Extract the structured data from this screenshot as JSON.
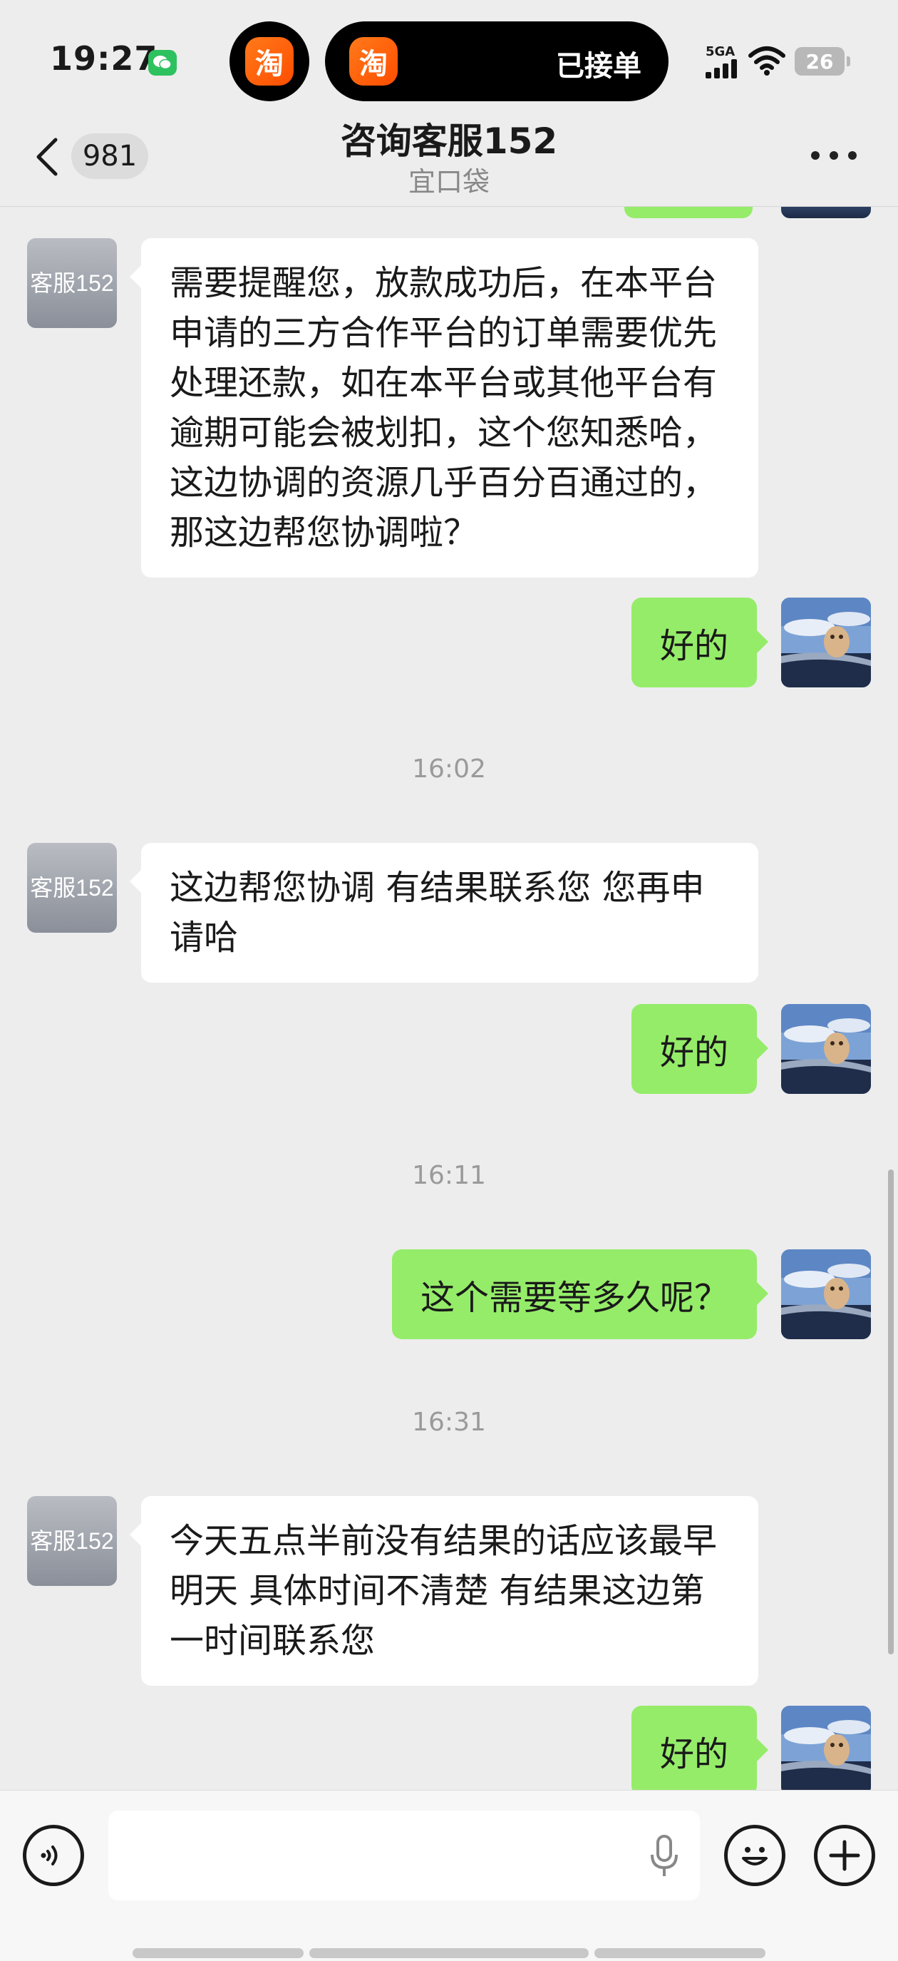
{
  "status_bar": {
    "time": "19:27",
    "island_app_glyph": "淘",
    "island_status": "已接单",
    "network": "5GA",
    "battery": "26"
  },
  "nav": {
    "unread_count": "981",
    "title": "咨询客服152",
    "subtitle": "宜口袋"
  },
  "agent_avatar_label": "客服152",
  "messages": {
    "m1": "需要提醒您，放款成功后，在本平台申请的三方合作平台的订单需要优先处理还款，如在本平台或其他平台有逾期可能会被划扣，这个您知悉哈，这边协调的资源几乎百分百通过的，那这边帮您协调啦？",
    "m2": "好的",
    "t1": "16:02",
    "m3": "这边帮您协调 有结果联系您 您再申请哈",
    "m4": "好的",
    "t2": "16:11",
    "m5": "这个需要等多久呢？",
    "t3": "16:31",
    "m6": "今天五点半前没有结果的话应该最早明天 具体时间不清楚 有结果这边第一时间联系您",
    "m7": "好的"
  },
  "icons": {
    "back": "chevron-left-icon",
    "more": "more-dots-icon",
    "voice": "voice-toggle-icon",
    "mic": "microphone-icon",
    "emoji": "emoji-icon",
    "add": "plus-icon"
  },
  "colors": {
    "background": "#ededed",
    "outgoing_bubble": "#95ec69",
    "incoming_bubble": "#ffffff",
    "wechat_green": "#2ec15f"
  }
}
